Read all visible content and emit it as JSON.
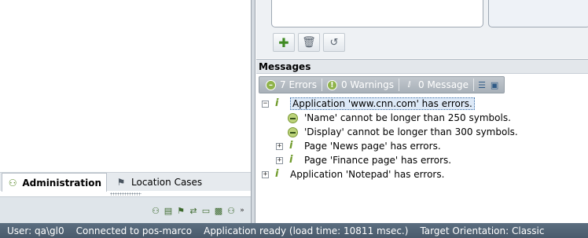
{
  "left_panel": {
    "tabs": [
      {
        "label": "Administration",
        "icon": "users-icon",
        "active": true
      },
      {
        "label": "Location Cases",
        "icon": "flag-icon",
        "active": false
      }
    ],
    "toolbar_icons": [
      "users-icon",
      "page-icon",
      "flag-icon",
      "route-icon",
      "monitor-icon",
      "cube-icon",
      "group-icon",
      "chevron-more-icon"
    ]
  },
  "right_panel": {
    "actions": [
      {
        "name": "add",
        "icon": "plus-icon"
      },
      {
        "name": "delete",
        "icon": "trash-icon"
      },
      {
        "name": "refresh",
        "icon": "refresh-icon"
      }
    ],
    "messages": {
      "title": "Messages",
      "filters": {
        "errors": "7 Errors",
        "warnings": "0 Warnings",
        "messages": "0 Message"
      },
      "tree": [
        {
          "text": "Application 'www.cnn.com' has errors.",
          "expander": "−",
          "selected": true
        },
        {
          "text": "'Name' cannot be longer than 250 symbols."
        },
        {
          "text": "'Display' cannot be longer than 300 symbols."
        },
        {
          "text": "Page 'News page' has errors.",
          "expander": "+"
        },
        {
          "text": "Page 'Finance page' has errors.",
          "expander": "+"
        },
        {
          "text": "Application 'Notepad' has errors.",
          "expander": "+"
        }
      ]
    }
  },
  "status_bar": {
    "user": "User: qa\\gl0",
    "connection": "Connected to pos-marco",
    "app_status": "Application ready (load time: 10811 msec.)",
    "orientation": "Target Orientation: Classic"
  },
  "colors": {
    "status_bar": "#4f6173",
    "error_icon": "#bcd37a",
    "selection": "#dde9f7"
  }
}
